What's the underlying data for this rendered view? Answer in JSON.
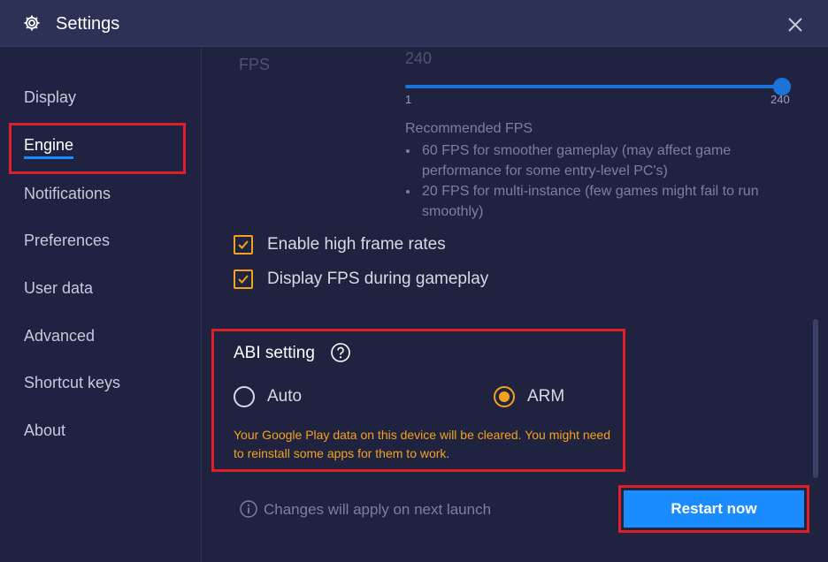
{
  "window": {
    "title": "Settings",
    "icons": {
      "title": "gear-icon",
      "close": "close-icon"
    }
  },
  "sidebar": {
    "items": [
      {
        "label": "Display"
      },
      {
        "label": "Engine",
        "active": true
      },
      {
        "label": "Notifications"
      },
      {
        "label": "Preferences"
      },
      {
        "label": "User data"
      },
      {
        "label": "Advanced"
      },
      {
        "label": "Shortcut keys"
      },
      {
        "label": "About"
      }
    ]
  },
  "fps": {
    "label": "FPS",
    "value": "240",
    "min_label": "1",
    "max_label": "240",
    "min": 1,
    "max": 240,
    "current": 240
  },
  "recommended": {
    "title": "Recommended FPS",
    "items": [
      "60 FPS for smoother gameplay (may affect game performance for some entry-level PC's)",
      "20 FPS for multi-instance (few games might fail to run smoothly)"
    ]
  },
  "options": {
    "high_frame_rates": {
      "label": "Enable high frame rates",
      "checked": true
    },
    "display_fps": {
      "label": "Display FPS during gameplay",
      "checked": true
    }
  },
  "abi": {
    "title": "ABI setting",
    "auto_label": "Auto",
    "arm_label": "ARM",
    "selected": "ARM",
    "warning": "Your Google Play data on this device will be cleared. You might need to reinstall some apps for them to work."
  },
  "footer": {
    "info_text": "Changes will apply on next launch",
    "restart_label": "Restart now"
  },
  "colors": {
    "accent": "#1a8cff",
    "warning": "#f3a21d",
    "highlight": "#e01e2a",
    "background": "#20233f"
  }
}
